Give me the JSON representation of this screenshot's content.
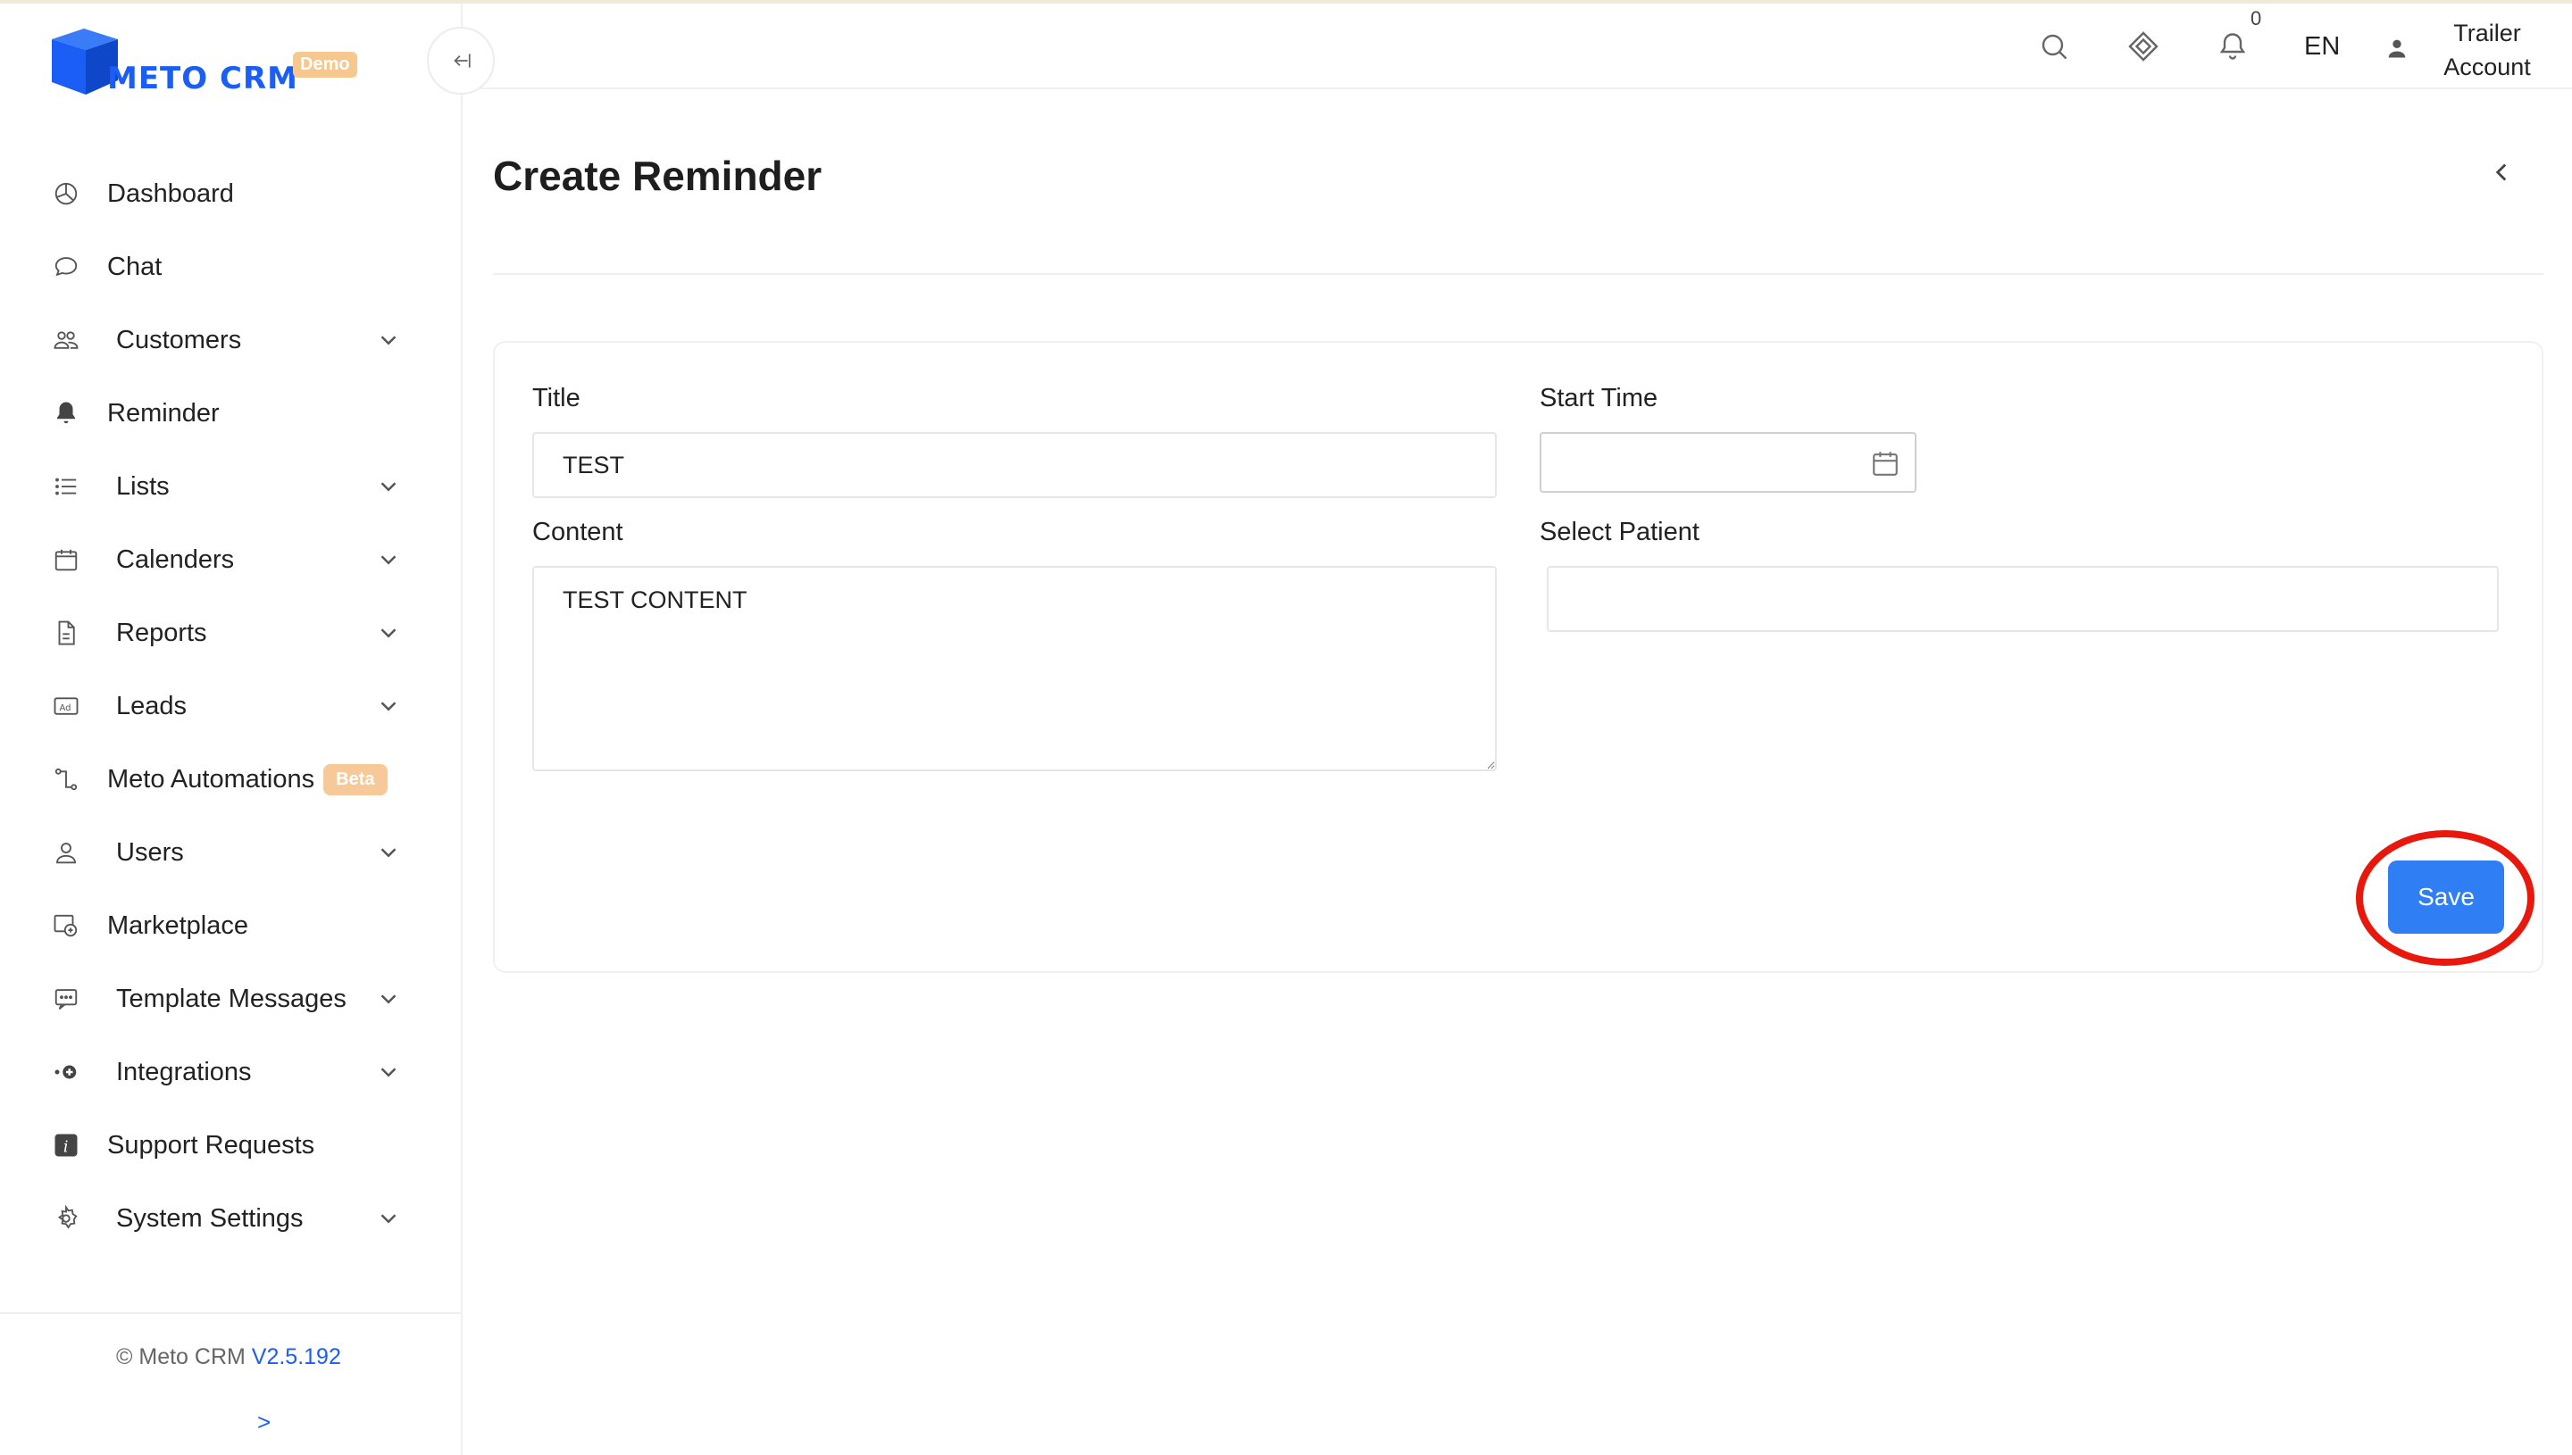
{
  "brand": {
    "name": "METO CRM",
    "badge": "Demo",
    "color": "#1b5ef5"
  },
  "sidebar": {
    "items": [
      {
        "label": "Dashboard",
        "icon": "dashboard-icon",
        "has_sub": false
      },
      {
        "label": "Chat",
        "icon": "chat-icon",
        "has_sub": false
      },
      {
        "label": "Customers",
        "icon": "customers-icon",
        "has_sub": true
      },
      {
        "label": "Reminder",
        "icon": "bell-icon",
        "has_sub": false
      },
      {
        "label": "Lists",
        "icon": "list-icon",
        "has_sub": true
      },
      {
        "label": "Calenders",
        "icon": "calendar-icon",
        "has_sub": true
      },
      {
        "label": "Reports",
        "icon": "report-icon",
        "has_sub": true
      },
      {
        "label": "Leads",
        "icon": "ad-icon",
        "has_sub": true
      },
      {
        "label": "Meto Automations",
        "icon": "automation-icon",
        "has_sub": false,
        "badge": "Beta"
      },
      {
        "label": "Users",
        "icon": "user-icon",
        "has_sub": true
      },
      {
        "label": "Marketplace",
        "icon": "marketplace-icon",
        "has_sub": false
      },
      {
        "label": "Template Messages",
        "icon": "template-icon",
        "has_sub": true
      },
      {
        "label": "Integrations",
        "icon": "integration-icon",
        "has_sub": true
      },
      {
        "label": "Support Requests",
        "icon": "info-icon",
        "has_sub": false
      },
      {
        "label": "System Settings",
        "icon": "gear-icon",
        "has_sub": true
      }
    ],
    "footer": {
      "copyright": "© Meto CRM",
      "version": "V2.5.192",
      "expand": ">"
    }
  },
  "header": {
    "notification_count": "0",
    "language": "EN",
    "account_line1": "Trailer",
    "account_line2": "Account"
  },
  "page": {
    "title": "Create Reminder",
    "form": {
      "title_label": "Title",
      "title_value": "TEST",
      "content_label": "Content",
      "content_value": "TEST CONTENT",
      "start_label": "Start Time",
      "start_value": "",
      "patient_label": "Select Patient",
      "patient_value": ""
    },
    "save_label": "Save",
    "accent": "#2f7ef4",
    "highlight_color": "#e8180c"
  }
}
